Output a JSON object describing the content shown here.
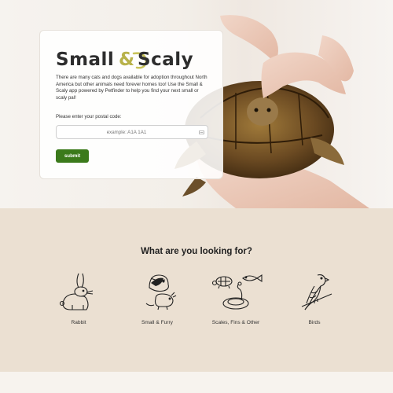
{
  "hero": {
    "logo_left": "Small",
    "logo_right": "Scaly",
    "logo_amp": "&",
    "intro": "There are many cats and dogs available for adoption throughout North America but other animals need forever homes too! Use the Small & Scaly app powered by Petfinder to help you find your next small or scaly pal!",
    "postal_label": "Please enter your postal code:",
    "postal_placeholder": "example: A1A 1A1",
    "postal_value": "",
    "submit_label": "submit",
    "accent": "#3b7a1b"
  },
  "categories": {
    "title": "What are you looking for?",
    "items": [
      {
        "label": "Rabbit",
        "icon": "rabbit-icon"
      },
      {
        "label": "Small & Furry",
        "icon": "guinea-pig-icon"
      },
      {
        "label": "Scales, Fins & Other",
        "icon": "turtle-fish-snake-icon"
      },
      {
        "label": "Birds",
        "icon": "bird-icon"
      }
    ]
  },
  "colors": {
    "section_bg": "#ebe0d2",
    "button": "#3b7a1b"
  }
}
